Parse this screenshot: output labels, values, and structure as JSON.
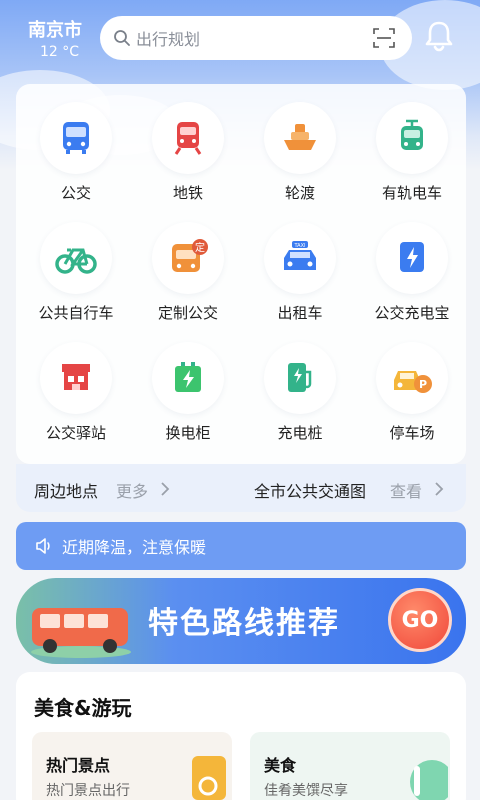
{
  "header": {
    "city": "南京市",
    "temperature": "12 °C",
    "search_placeholder": "出行规划"
  },
  "services": [
    {
      "label": "公交",
      "icon": "bus-icon"
    },
    {
      "label": "地铁",
      "icon": "subway-icon"
    },
    {
      "label": "轮渡",
      "icon": "ferry-icon"
    },
    {
      "label": "有轨电车",
      "icon": "tram-icon"
    },
    {
      "label": "公共自行车",
      "icon": "bicycle-icon"
    },
    {
      "label": "定制公交",
      "icon": "custom-bus-icon",
      "badge": "定"
    },
    {
      "label": "出租车",
      "icon": "taxi-icon",
      "badge": "TAXI"
    },
    {
      "label": "公交充电宝",
      "icon": "power-bank-icon"
    },
    {
      "label": "公交驿站",
      "icon": "station-icon"
    },
    {
      "label": "换电柜",
      "icon": "battery-swap-icon"
    },
    {
      "label": "充电桩",
      "icon": "charging-pile-icon"
    },
    {
      "label": "停车场",
      "icon": "parking-icon",
      "badge": "P"
    }
  ],
  "nearby": {
    "left_title": "周边地点",
    "left_more": "更多",
    "right_title": "全市公共交通图",
    "right_more": "查看"
  },
  "notice": {
    "text": "近期降温，注意保暖"
  },
  "banner": {
    "title": "特色路线推荐",
    "go": "GO"
  },
  "food": {
    "title": "美食&游玩",
    "cards": [
      {
        "title": "热门景点",
        "subtitle": "热门景点出行"
      },
      {
        "title": "美食",
        "subtitle": "佳肴美馔尽享"
      }
    ]
  },
  "colors": {
    "accent": "#3a74ee",
    "notice": "#6e9cf3",
    "bus": "#3b7cf0",
    "subway": "#e54545",
    "ferry": "#f0913a",
    "tram": "#33b38a"
  }
}
